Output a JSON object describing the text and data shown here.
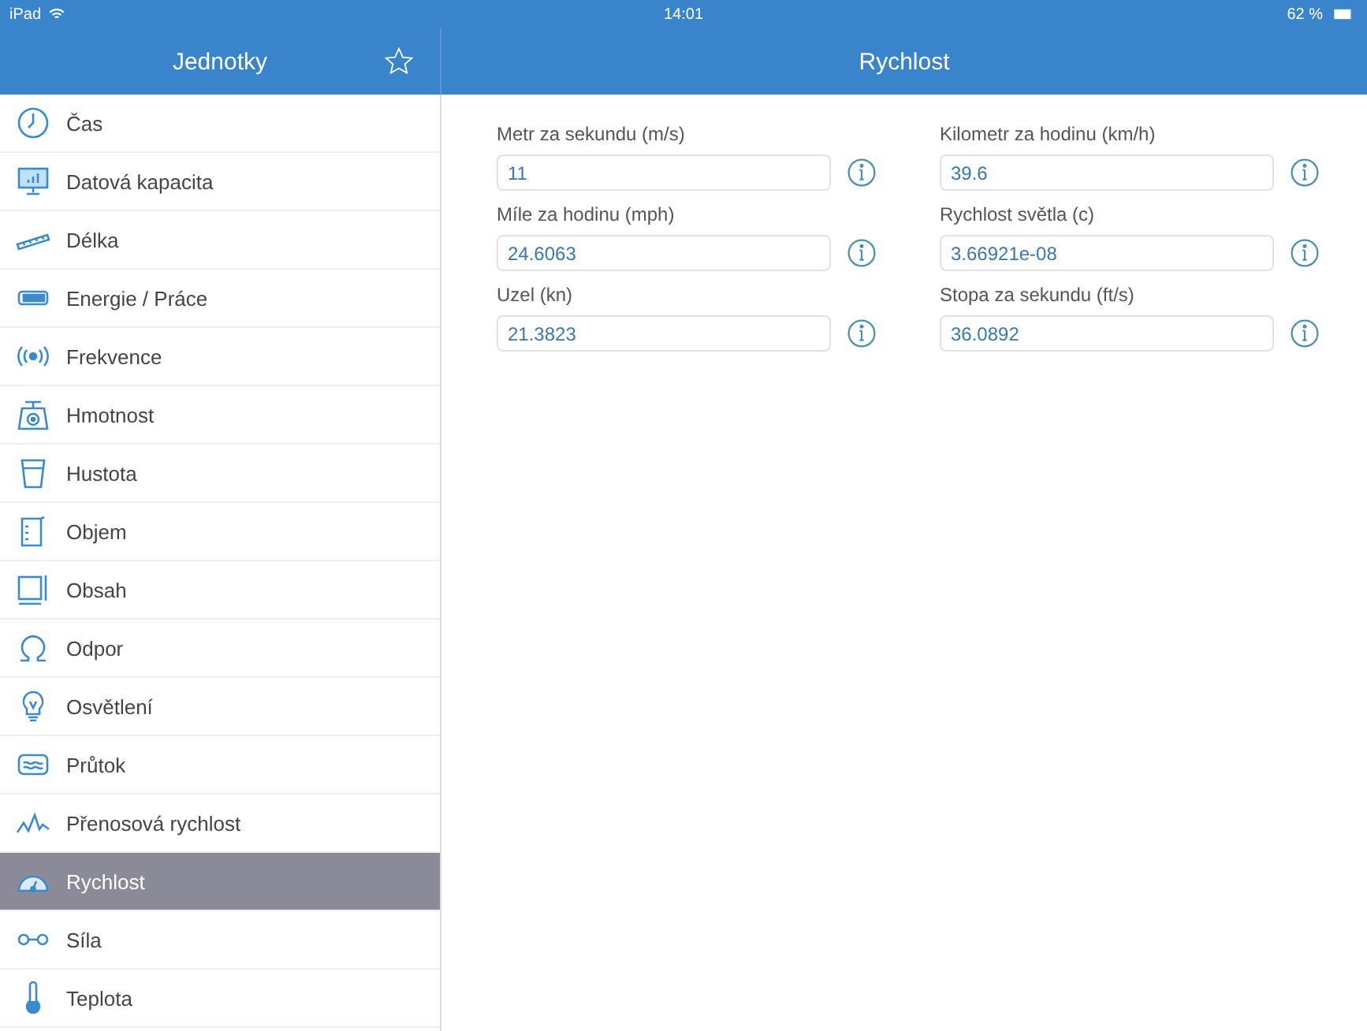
{
  "status_bar": {
    "device": "iPad",
    "time": "14:01",
    "battery": "62 %"
  },
  "sidebar": {
    "title": "Jednotky",
    "items": [
      {
        "label": "Čas",
        "selected": false
      },
      {
        "label": "Datová kapacita",
        "selected": false
      },
      {
        "label": "Délka",
        "selected": false
      },
      {
        "label": "Energie / Práce",
        "selected": false
      },
      {
        "label": "Frekvence",
        "selected": false
      },
      {
        "label": "Hmotnost",
        "selected": false
      },
      {
        "label": "Hustota",
        "selected": false
      },
      {
        "label": "Objem",
        "selected": false
      },
      {
        "label": "Obsah",
        "selected": false
      },
      {
        "label": "Odpor",
        "selected": false
      },
      {
        "label": "Osvětlení",
        "selected": false
      },
      {
        "label": "Průtok",
        "selected": false
      },
      {
        "label": "Přenosová rychlost",
        "selected": false
      },
      {
        "label": "Rychlost",
        "selected": true
      },
      {
        "label": "Síla",
        "selected": false
      },
      {
        "label": "Teplota",
        "selected": false
      }
    ]
  },
  "detail": {
    "title": "Rychlost",
    "fields": [
      {
        "label": "Metr za sekundu (m/s)",
        "value": "11"
      },
      {
        "label": "Kilometr za hodinu (km/h)",
        "value": "39.6"
      },
      {
        "label": "Míle za hodinu (mph)",
        "value": "24.6063"
      },
      {
        "label": "Rychlost světla (c)",
        "value": "3.66921e-08"
      },
      {
        "label": "Uzel (kn)",
        "value": "21.3823"
      },
      {
        "label": "Stopa za sekundu (ft/s)",
        "value": "36.0892"
      }
    ]
  }
}
